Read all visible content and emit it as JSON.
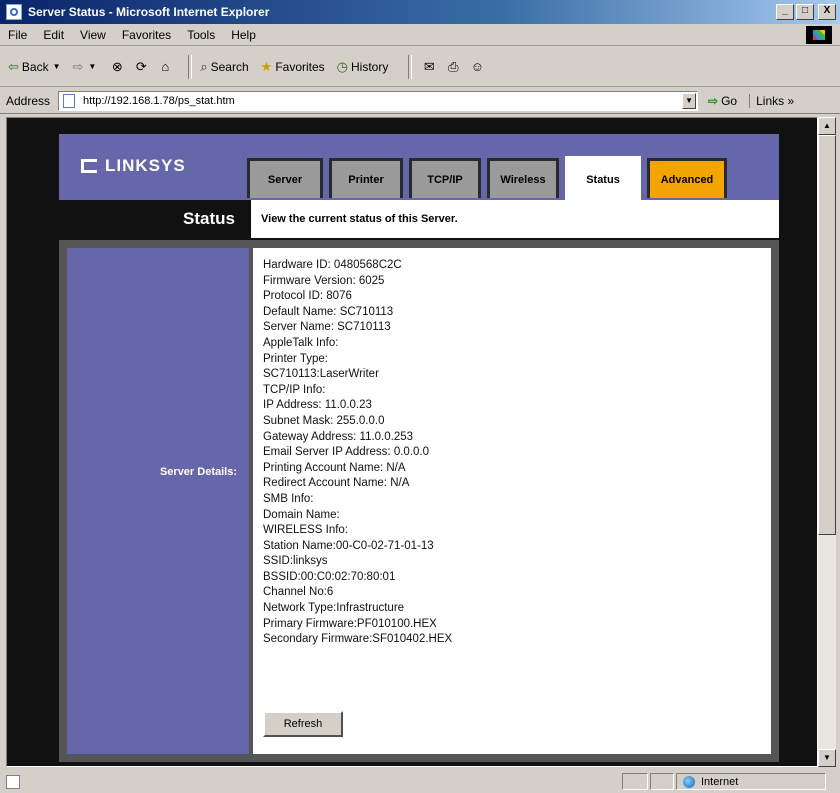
{
  "window": {
    "title": "Server Status - Microsoft Internet Explorer",
    "buttons": [
      "_",
      "□",
      "X"
    ]
  },
  "menu": [
    "File",
    "Edit",
    "View",
    "Favorites",
    "Tools",
    "Help"
  ],
  "toolbar": {
    "back": "Back",
    "search": "Search",
    "favorites": "Favorites",
    "history": "History"
  },
  "address": {
    "label": "Address",
    "url": "http://192.168.1.78/ps_stat.htm",
    "go": "Go",
    "links": "Links »"
  },
  "page": {
    "brand": "LINKSYS",
    "tabs": [
      {
        "label": "Server",
        "active": false
      },
      {
        "label": "Printer",
        "active": false
      },
      {
        "label": "TCP/IP",
        "active": false
      },
      {
        "label": "Wireless",
        "active": false
      },
      {
        "label": "Status",
        "active": true
      },
      {
        "label": "Advanced",
        "active": false
      }
    ],
    "section_title": "Status",
    "description": "View the current status of this Server.",
    "left_label": "Server Details:",
    "details": [
      "Hardware ID: 0480568C2C",
      "Firmware Version: 6025",
      "Protocol ID: 8076",
      "Default Name: SC710113",
      "Server Name: SC710113",
      "AppleTalk Info:",
      "Printer Type:",
      "SC710113:LaserWriter",
      "TCP/IP Info:",
      "IP Address: 11.0.0.23",
      "Subnet Mask: 255.0.0.0",
      "Gateway Address: 11.0.0.253",
      "Email Server IP Address: 0.0.0.0",
      "Printing Account Name: N/A",
      "Redirect Account Name: N/A",
      "SMB Info:",
      "Domain Name:",
      "WIRELESS Info:",
      "Station Name:00-C0-02-71-01-13",
      "SSID:linksys",
      "BSSID:00:C0:02:70:80:01",
      "Channel No:6",
      "Network Type:Infrastructure",
      "Primary Firmware:PF010100.HEX",
      "Secondary Firmware:SF010402.HEX"
    ],
    "refresh_label": "Refresh"
  },
  "status": {
    "zone": "Internet"
  },
  "colors": {
    "linksys_purple": "#6666aa",
    "advanced_orange": "#f2a400",
    "title_bar": "#0a246a"
  }
}
